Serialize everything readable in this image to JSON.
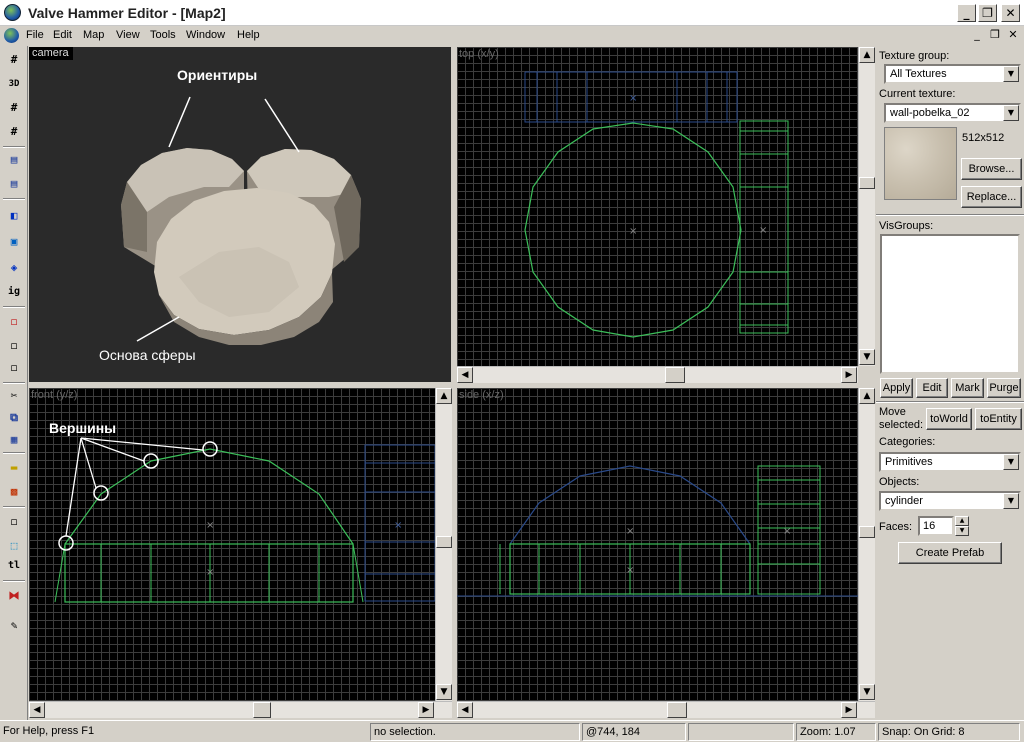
{
  "window": {
    "title": "Valve Hammer Editor - [Map2]"
  },
  "menu": {
    "items": [
      "File",
      "Edit",
      "Map",
      "View",
      "Tools",
      "Window",
      "Help"
    ]
  },
  "viewports": {
    "camera": {
      "label": "camera",
      "annotations": {
        "landmarks": "Ориентиры",
        "sphere_base": "Основа сферы"
      }
    },
    "top": {
      "label": "top (x/y)"
    },
    "front": {
      "label": "front (y/z)",
      "annotations": {
        "vertices": "Вершины"
      }
    },
    "side": {
      "label": "side (x/z)"
    }
  },
  "texture_panel": {
    "group_label": "Texture group:",
    "group_value": "All Textures",
    "current_label": "Current texture:",
    "current_value": "wall-pobelka_02",
    "size": "512x512",
    "browse": "Browse...",
    "replace": "Replace..."
  },
  "visgroups": {
    "label": "VisGroups:",
    "apply": "Apply",
    "edit": "Edit",
    "mark": "Mark",
    "purge": "Purge"
  },
  "object_panel": {
    "move_selected_1": "Move",
    "move_selected_2": "selected:",
    "to_world": "toWorld",
    "to_entity": "toEntity",
    "categories_label": "Categories:",
    "categories_value": "Primitives",
    "objects_label": "Objects:",
    "objects_value": "cylinder",
    "faces_label": "Faces:",
    "faces_value": "16",
    "create_prefab": "Create Prefab"
  },
  "status": {
    "help": "For Help, press F1",
    "selection": "no selection.",
    "coords": "@744, 184",
    "zoom": "Zoom: 1.07",
    "snap": "Snap: On Grid: 8"
  }
}
